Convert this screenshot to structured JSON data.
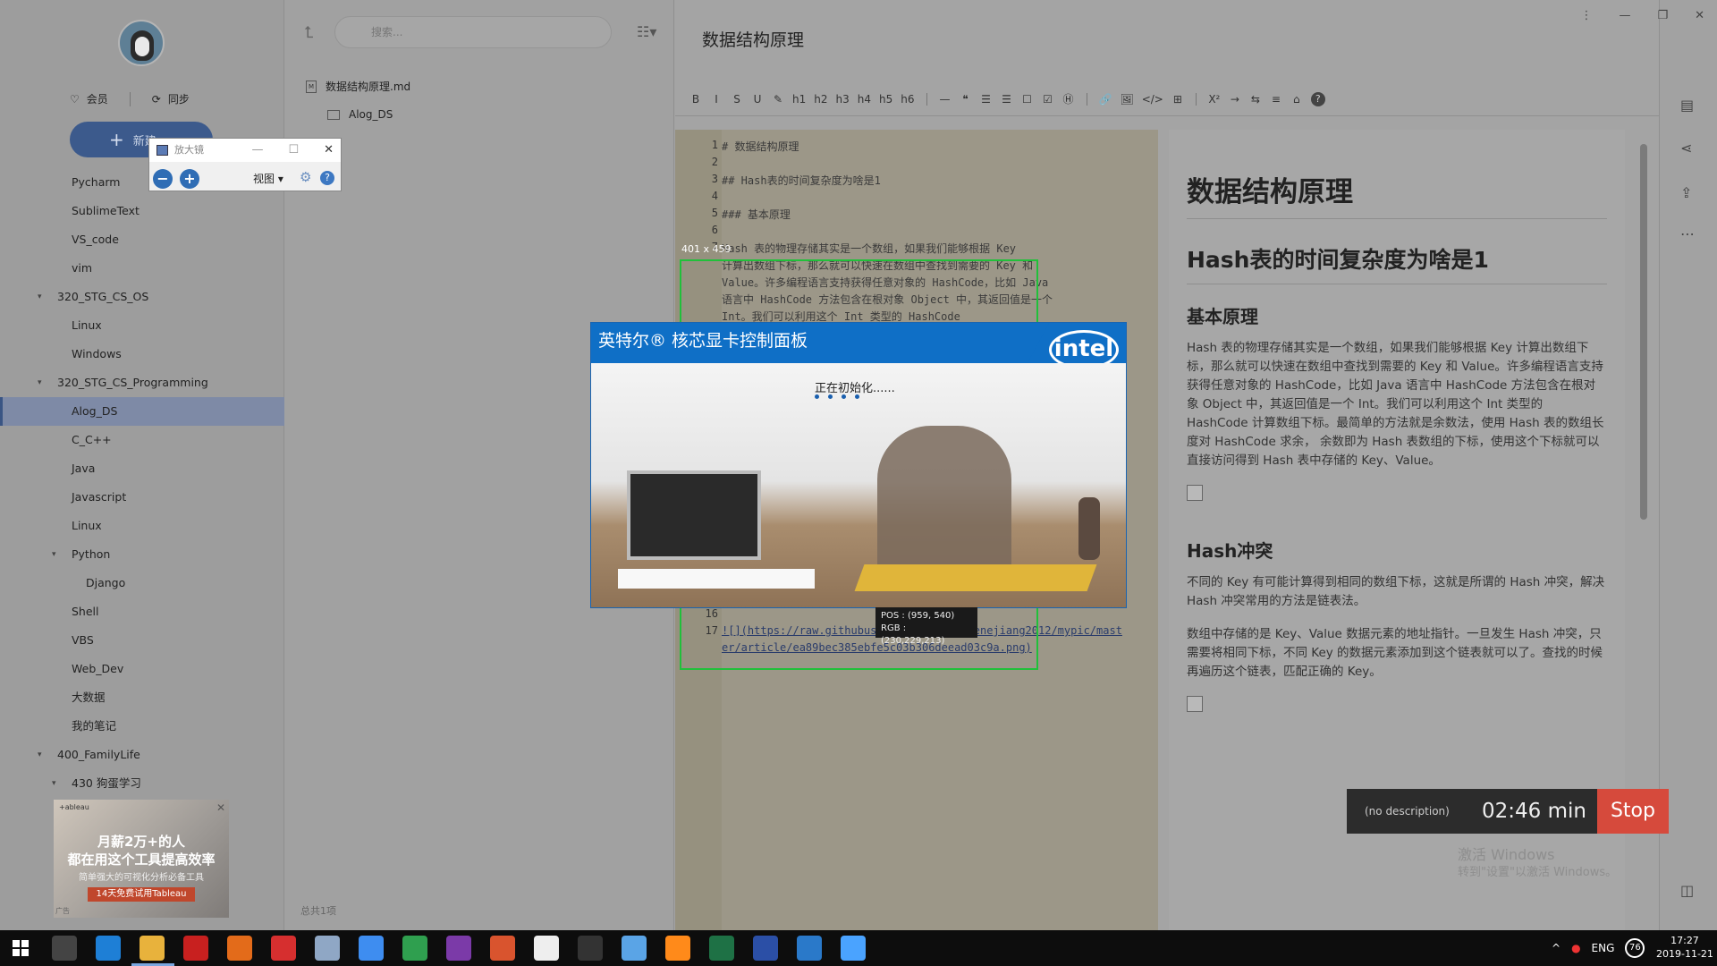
{
  "sidebar": {
    "member_label": "会员",
    "sync_label": "同步",
    "new_button_label": "新建",
    "tree": [
      {
        "label": "Pycharm",
        "level": 2
      },
      {
        "label": "SublimeText",
        "level": 2
      },
      {
        "label": "VS_code",
        "level": 2
      },
      {
        "label": "vim",
        "level": 2
      },
      {
        "label": "320_STG_CS_OS",
        "level": 1,
        "expanded": true
      },
      {
        "label": "Linux",
        "level": 2
      },
      {
        "label": "Windows",
        "level": 2
      },
      {
        "label": "320_STG_CS_Programming",
        "level": 1,
        "expanded": true
      },
      {
        "label": "Alog_DS",
        "level": 2,
        "active": true
      },
      {
        "label": "C_C++",
        "level": 2
      },
      {
        "label": "Java",
        "level": 2
      },
      {
        "label": "Javascript",
        "level": 2
      },
      {
        "label": "Linux",
        "level": 2
      },
      {
        "label": "Python",
        "level": 2,
        "expanded": true
      },
      {
        "label": "Django",
        "level": 3
      },
      {
        "label": "Shell",
        "level": 2
      },
      {
        "label": "VBS",
        "level": 2
      },
      {
        "label": "Web_Dev",
        "level": 2
      },
      {
        "label": "大数据",
        "level": 2
      },
      {
        "label": "我的笔记",
        "level": 2
      },
      {
        "label": "400_FamilyLife",
        "level": 1,
        "expanded": true
      },
      {
        "label": "430 狗蛋学习",
        "level": 2,
        "expanded": true
      }
    ],
    "ad": {
      "brand": "+ableau",
      "line1": "月薪2万+的人",
      "line2": "都在用这个工具提高效率",
      "line3": "简单强大的可视化分析必备工具",
      "button": "14天免费试用Tableau",
      "tag": "广告"
    }
  },
  "filelist": {
    "search_placeholder": "搜索...",
    "files": [
      {
        "name": "数据结构原理.md",
        "type": "md"
      },
      {
        "name": "Alog_DS",
        "type": "folder"
      }
    ],
    "footer": "总共1项"
  },
  "editor": {
    "doc_title": "数据结构原理",
    "toolbar": [
      "B",
      "I",
      "S",
      "U",
      "✎",
      "h1",
      "h2",
      "h3",
      "h4",
      "h5",
      "h6",
      "—",
      "❝",
      "☰",
      "☰",
      "☐",
      "☑",
      "Ⓗ",
      "🔗",
      "🖼",
      "</>",
      "⊞",
      "X²",
      "→",
      "⇆",
      "≡",
      "⌂",
      "?"
    ],
    "lines": [
      {
        "n": "1",
        "text": "# 数据结构原理"
      },
      {
        "n": "2",
        "text": ""
      },
      {
        "n": "3",
        "text": "## Hash表的时间复杂度为啥是1"
      },
      {
        "n": "4",
        "text": ""
      },
      {
        "n": "5",
        "text": "### 基本原理"
      },
      {
        "n": "6",
        "text": ""
      },
      {
        "n": "7",
        "text": "Hash 表的物理存储其实是一个数组，如果我们能够根据 Key"
      },
      {
        "n": "",
        "text": "计算出数组下标，那么就可以快速在数组中查找到需要的 Key 和"
      },
      {
        "n": "",
        "text": "Value。许多编程语言支持获得任意对象的 HashCode，比如 Java"
      },
      {
        "n": "",
        "text": "语言中 HashCode 方法包含在根对象 Object 中，其返回值是一个"
      },
      {
        "n": "",
        "text": "Int。我们可以利用这个 Int 类型的 HashCode"
      }
    ],
    "bottom_lines": [
      {
        "n": "16",
        "text": ""
      },
      {
        "n": "17",
        "text": "![](https://raw.githubusercontent.com/genejiang2012/mypic/mast"
      },
      {
        "n": "",
        "text": "er/article/ea89bec385ebfe5c03b306deead03c9a.png)"
      }
    ],
    "preview": {
      "h1": "数据结构原理",
      "h2": "Hash表的时间复杂度为啥是1",
      "h3_1": "基本原理",
      "p1": "Hash 表的物理存储其实是一个数组，如果我们能够根据 Key 计算出数组下标，那么就可以快速在数组中查找到需要的 Key 和 Value。许多编程语言支持获得任意对象的 HashCode，比如 Java 语言中 HashCode 方法包含在根对象 Object 中，其返回值是一个 Int。我们可以利用这个 Int 类型的 HashCode 计算数组下标。最简单的方法就是余数法，使用 Hash 表的数组长度对 HashCode 求余， 余数即为 Hash 表数组的下标，使用这个下标就可以直接访问得到 Hash 表中存储的 Key、Value。",
      "h3_2": "Hash冲突",
      "p2": "不同的 Key 有可能计算得到相同的数组下标，这就是所谓的 Hash 冲突，解决 Hash 冲突常用的方法是链表法。",
      "p3": "数组中存储的是 Key、Value 数据元素的地址指针。一旦发生 Hash 冲突，只需要将相同下标，不同 Key 的数据元素添加到这个链表就可以了。查找的时候再遍历这个链表，匹配正确的 Key。"
    }
  },
  "capture": {
    "size_label": "401 x 459"
  },
  "magnifier": {
    "title": "放大镜",
    "view_label": "视图"
  },
  "intel": {
    "title": "英特尔® 核芯显卡控制面板",
    "logo": "intel",
    "status": "正在初始化......"
  },
  "pos_tooltip": {
    "pos": "POS : (959, 540)",
    "rgb": "RGB : (230,229,213)"
  },
  "timer": {
    "description": "(no description)",
    "time": "02:46 min",
    "stop": "Stop"
  },
  "watermark": {
    "line1": "激活 Windows",
    "line2": "转到\"设置\"以激活 Windows。"
  },
  "taskbar": {
    "lang": "ENG",
    "badge": "76",
    "time": "17:27",
    "date": "2019-11-21",
    "apps": [
      "task-view",
      "ie",
      "file-explorer",
      "pdf-reader",
      "firefox",
      "youdao",
      "scanner",
      "notes",
      "chrome",
      "onenote",
      "weibo",
      "github",
      "terminal",
      "paint",
      "search-tool",
      "excel",
      "tool",
      "browser",
      "pin"
    ],
    "app_colors": [
      "#444",
      "#1e7fd6",
      "#e8b23c",
      "#c8201f",
      "#e36b1a",
      "#d62f2f",
      "#8fa7c5",
      "#3e8df0",
      "#2f9f4f",
      "#7b3aa8",
      "#d9542e",
      "#eeeeee",
      "#333",
      "#5aa4e6",
      "#ff8a1a",
      "#1e7145",
      "#2b4fa6",
      "#2a79c9",
      "#4aa3ff"
    ]
  },
  "colors": {
    "accent": "#3c5a8c",
    "intel_blue": "#0f6fc6",
    "stop_red": "#d64a3c",
    "capture_green": "#21c03a"
  }
}
